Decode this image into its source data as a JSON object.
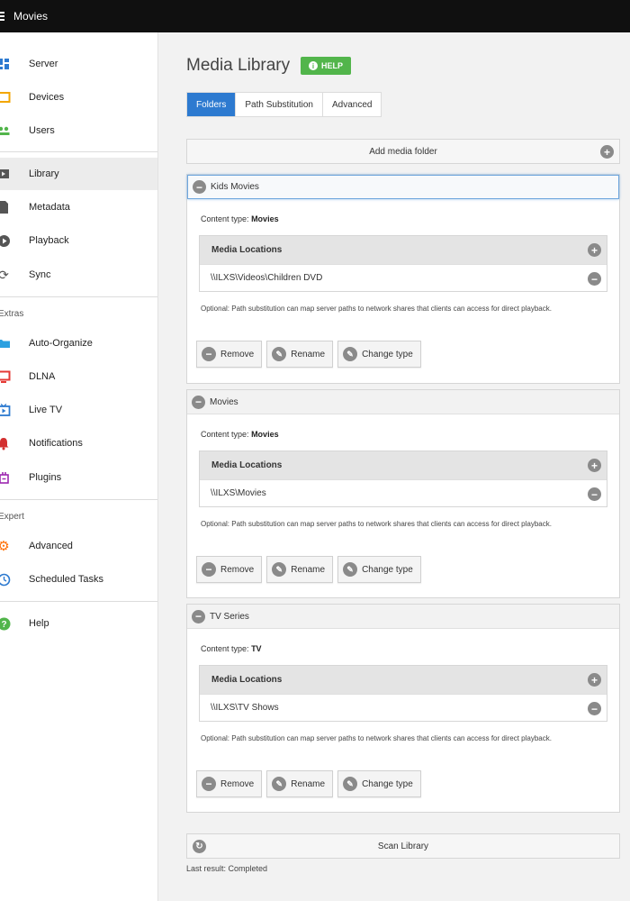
{
  "app": {
    "title": "Movies"
  },
  "sidebar": {
    "items": [
      {
        "label": "Server",
        "icon": "dashboard-icon",
        "color": "#2d7ad0"
      },
      {
        "label": "Devices",
        "icon": "tablet-icon",
        "color": "#f3a600"
      },
      {
        "label": "Users",
        "icon": "people-icon",
        "color": "#52b54b"
      },
      {
        "label": "Library",
        "icon": "folder-video-icon",
        "color": "#444444"
      },
      {
        "label": "Metadata",
        "icon": "document-icon",
        "color": "#444444"
      },
      {
        "label": "Playback",
        "icon": "play-circle-icon",
        "color": "#444444"
      },
      {
        "label": "Sync",
        "icon": "sync-icon",
        "color": "#444444"
      },
      {
        "label": "Auto-Organize",
        "icon": "folder-icon",
        "color": "#2ba0e0"
      },
      {
        "label": "DLNA",
        "icon": "tv-icon",
        "color": "#e53935"
      },
      {
        "label": "Live TV",
        "icon": "live-tv-icon",
        "color": "#2d7ad0"
      },
      {
        "label": "Notifications",
        "icon": "bell-icon",
        "color": "#d32f2f"
      },
      {
        "label": "Plugins",
        "icon": "plugin-icon",
        "color": "#9c27b0"
      },
      {
        "label": "Advanced",
        "icon": "gear-icon",
        "color": "#ff6d00"
      },
      {
        "label": "Scheduled Tasks",
        "icon": "clock-icon",
        "color": "#2d7ad0"
      },
      {
        "label": "Help",
        "icon": "help-icon",
        "color": "#52b54b"
      }
    ],
    "headings": {
      "extras": "Extras",
      "expert": "Expert"
    }
  },
  "main": {
    "title": "Media Library",
    "help_label": "HELP",
    "tabs": [
      {
        "label": "Folders",
        "active": true
      },
      {
        "label": "Path Substitution",
        "active": false
      },
      {
        "label": "Advanced",
        "active": false
      }
    ],
    "add_folder_label": "Add media folder",
    "folders": [
      {
        "name": "Kids Movies",
        "content_type_label": "Content type:",
        "content_type": "Movies",
        "locations_header": "Media Locations",
        "locations": [
          "\\\\ILXS\\Videos\\Children DVD"
        ],
        "note": "Optional: Path substitution can map server paths to network shares that clients can access for direct playback.",
        "actions": [
          "Remove",
          "Rename",
          "Change type"
        ]
      },
      {
        "name": "Movies",
        "content_type_label": "Content type:",
        "content_type": "Movies",
        "locations_header": "Media Locations",
        "locations": [
          "\\\\ILXS\\Movies"
        ],
        "note": "Optional: Path substitution can map server paths to network shares that clients can access for direct playback.",
        "actions": [
          "Remove",
          "Rename",
          "Change type"
        ]
      },
      {
        "name": "TV Series",
        "content_type_label": "Content type:",
        "content_type": "TV",
        "locations_header": "Media Locations",
        "locations": [
          "\\\\ILXS\\TV Shows"
        ],
        "note": "Optional: Path substitution can map server paths to network shares that clients can access for direct playback.",
        "actions": [
          "Remove",
          "Rename",
          "Change type"
        ]
      }
    ],
    "scan_label": "Scan Library",
    "last_result": "Last result: Completed"
  }
}
